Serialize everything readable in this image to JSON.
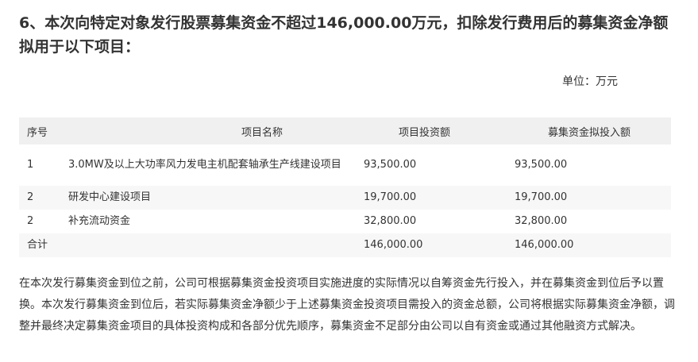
{
  "heading": "6、本次向特定对象发行股票募集资金不超过146,000.00万元，扣除发行费用后的募集资金净额拟用于以下项目：",
  "unit_label": "单位：万元",
  "table": {
    "headers": {
      "seq": "序号",
      "name": "项目名称",
      "investment": "项目投资额",
      "raised": "募集资金拟投入额"
    },
    "rows": [
      {
        "seq": "1",
        "name": "3.0MW及以上大功率风力发电主机配套轴承生产线建设项目",
        "investment": "93,500.00",
        "raised": "93,500.00"
      },
      {
        "seq": "2",
        "name": "研发中心建设项目",
        "investment": "19,700.00",
        "raised": "19,700.00"
      },
      {
        "seq": "2",
        "name": "补充流动资金",
        "investment": "32,800.00",
        "raised": "32,800.00"
      }
    ],
    "total": {
      "label": "合计",
      "investment": "146,000.00",
      "raised": "146,000.00"
    }
  },
  "paragraph": "在本次发行募集资金到位之前，公司可根据募集资金投资项目实施进度的实际情况以自筹资金先行投入，并在募集资金到位后予以置换。本次发行募集资金到位后，若实际募集资金净额少于上述募集资金投资项目需投入的资金总额，公司将根据实际募集资金净额，调整并最终决定募集资金项目的具体投资构成和各部分优先顺序，募集资金不足部分由公司以自有资金或通过其他融资方式解决。"
}
